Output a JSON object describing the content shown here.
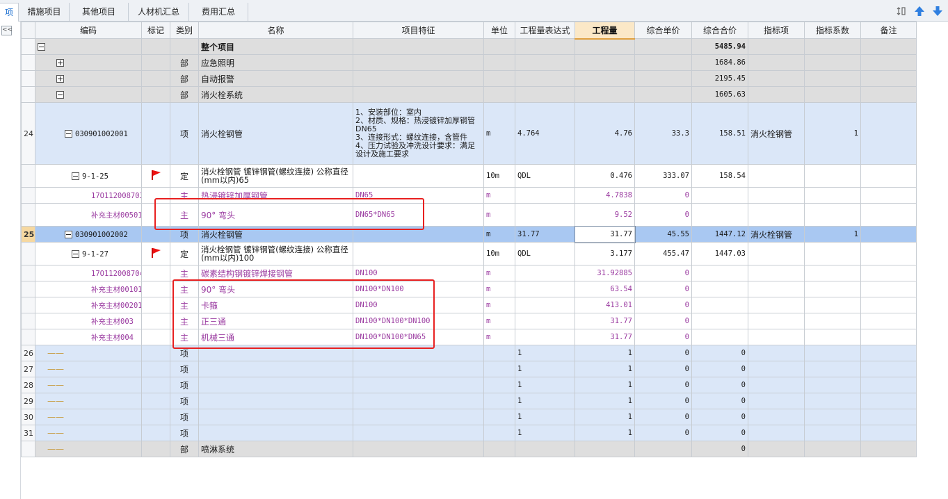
{
  "tabs": [
    {
      "label": "项"
    },
    {
      "label": "措施项目"
    },
    {
      "label": "其他项目"
    },
    {
      "label": "人材机汇总"
    },
    {
      "label": "费用汇总"
    }
  ],
  "columns": [
    "编码",
    "标记",
    "类别",
    "名称",
    "项目特征",
    "单位",
    "工程量表达式",
    "工程量",
    "综合单价",
    "综合合价",
    "指标项",
    "指标系数",
    "备注"
  ],
  "collapse_label": "<<",
  "rows": [
    {
      "type": "grey",
      "code": "",
      "cat": "",
      "name": "整个项目",
      "total": "5485.94"
    },
    {
      "type": "grey",
      "code": "",
      "cat": "部",
      "name": "应急照明",
      "total": "1684.86"
    },
    {
      "type": "grey",
      "code": "",
      "cat": "部",
      "name": "自动报警",
      "total": "2195.45"
    },
    {
      "type": "grey",
      "code": "",
      "cat": "部",
      "name": "消火栓系统",
      "total": "1605.63"
    },
    {
      "rowno": "24",
      "code": "030901002001",
      "cat": "项",
      "name": "消火栓钢管",
      "feature": "1、安装部位：室内\n2、材质、规格：热浸镀锌加厚钢管 DN65\n3、连接形式：螺纹连接，含管件\n4、压力试验及冲洗设计要求：满足设计及施工要求",
      "unit": "m",
      "expr": "4.764",
      "qty": "4.76",
      "price": "33.3",
      "total": "158.51",
      "index": "消火栓钢管",
      "coef": "1"
    },
    {
      "code": "9-1-25",
      "cat": "定",
      "name": "消火栓钢管 镀锌钢管(螺纹连接) 公称直径(mm以内)65",
      "unit": "10m",
      "expr": "QDL",
      "qty": "0.476",
      "price": "333.07",
      "total": "158.54"
    },
    {
      "code": "17O112008703",
      "cat": "主",
      "name": "热浸镀锌加厚钢管",
      "feature": "DN65",
      "unit": "m",
      "qty": "4.7838",
      "price": "0"
    },
    {
      "code": "补充主材00501",
      "cat": "主",
      "name": "90° 弯头",
      "feature": "DN65*DN65",
      "unit": "m",
      "qty": "9.52",
      "price": "0"
    },
    {
      "rowno": "25",
      "code": "030901002002",
      "cat": "项",
      "name": "消火栓钢管",
      "unit": "m",
      "expr": "31.77",
      "qty": "31.77",
      "price": "45.55",
      "total": "1447.12",
      "index": "消火栓钢管",
      "coef": "1"
    },
    {
      "code": "9-1-27",
      "cat": "定",
      "name": "消火栓钢管 镀锌钢管(螺纹连接) 公称直径(mm以内)100",
      "unit": "10m",
      "expr": "QDL",
      "qty": "3.177",
      "price": "455.47",
      "total": "1447.03"
    },
    {
      "code": "17O112008704",
      "cat": "主",
      "name": "碳素结构钢镀锌焊接钢管",
      "feature": "DN100",
      "unit": "m",
      "qty": "31.92885",
      "price": "0"
    },
    {
      "code": "补充主材00101",
      "cat": "主",
      "name": "90° 弯头",
      "feature": "DN100*DN100",
      "unit": "m",
      "qty": "63.54",
      "price": "0"
    },
    {
      "code": "补充主材00201",
      "cat": "主",
      "name": "卡箍",
      "feature": "DN100",
      "unit": "m",
      "qty": "413.01",
      "price": "0"
    },
    {
      "code": "补充主材003",
      "cat": "主",
      "name": "正三通",
      "feature": "DN100*DN100*DN100",
      "unit": "m",
      "qty": "31.77",
      "price": "0"
    },
    {
      "code": "补充主材004",
      "cat": "主",
      "name": "机械三通",
      "feature": "DN100*DN100*DN65",
      "unit": "m",
      "qty": "31.77",
      "price": "0"
    },
    {
      "rowno": "26",
      "cat": "项",
      "expr": "1",
      "qty": "1",
      "price": "0",
      "total": "0"
    },
    {
      "rowno": "27",
      "cat": "项",
      "expr": "1",
      "qty": "1",
      "price": "0",
      "total": "0"
    },
    {
      "rowno": "28",
      "cat": "项",
      "expr": "1",
      "qty": "1",
      "price": "0",
      "total": "0"
    },
    {
      "rowno": "29",
      "cat": "项",
      "expr": "1",
      "qty": "1",
      "price": "0",
      "total": "0"
    },
    {
      "rowno": "30",
      "cat": "项",
      "expr": "1",
      "qty": "1",
      "price": "0",
      "total": "0"
    },
    {
      "rowno": "31",
      "cat": "项",
      "expr": "1",
      "qty": "1",
      "price": "0",
      "total": "0"
    },
    {
      "type": "grey",
      "cat": "部",
      "name": "喷淋系统",
      "total": "0"
    }
  ]
}
